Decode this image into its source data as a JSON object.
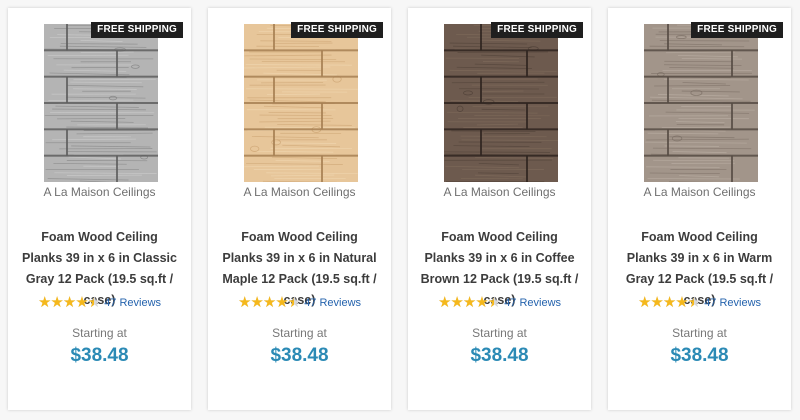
{
  "theme": {
    "accent": "#2b8ab5",
    "link": "#2563ad",
    "star": "#f5b81c",
    "badge_bg": "#1f1f1f"
  },
  "products": [
    {
      "badge": "FREE SHIPPING",
      "brand": "A La Maison Ceilings",
      "title": "Foam Wood Ceiling Planks 39 in x 6 in Classic Gray 12 Pack (19.5 sq.ft / case)",
      "rating": 4.5,
      "reviews": "47 Reviews",
      "from_label": "Starting at",
      "price": "$38.48",
      "swatch": {
        "base": "#b4b4b4",
        "dark": "#7c7c7c",
        "light": "#d4d4d4",
        "seam": "#5e5e5e"
      }
    },
    {
      "badge": "FREE SHIPPING",
      "brand": "A La Maison Ceilings",
      "title": "Foam Wood Ceiling Planks 39 in x 6 in Natural Maple 12 Pack (19.5 sq.ft / case)",
      "rating": 4.5,
      "reviews": "47 Reviews",
      "from_label": "Starting at",
      "price": "$38.48",
      "swatch": {
        "base": "#e7c69a",
        "dark": "#c99f6d",
        "light": "#f3dcb8",
        "seam": "#a67f52"
      }
    },
    {
      "badge": "FREE SHIPPING",
      "brand": "A La Maison Ceilings",
      "title": "Foam Wood Ceiling Planks 39 in x 6 in Coffee Brown 12 Pack (19.5 sq.ft / case)",
      "rating": 4.5,
      "reviews": "47 Reviews",
      "from_label": "Starting at",
      "price": "$38.48",
      "swatch": {
        "base": "#6d5a4e",
        "dark": "#4b3d34",
        "light": "#85715f",
        "seam": "#2f2520"
      }
    },
    {
      "badge": "FREE SHIPPING",
      "brand": "A La Maison Ceilings",
      "title": "Foam Wood Ceiling Planks 39 in x 6 in Warm Gray 12 Pack (19.5 sq.ft / case)",
      "rating": 4.5,
      "reviews": "47 Reviews",
      "from_label": "Starting at",
      "price": "$38.48",
      "swatch": {
        "base": "#a2958a",
        "dark": "#76695f",
        "light": "#c2b6ab",
        "seam": "#574c44"
      }
    }
  ]
}
